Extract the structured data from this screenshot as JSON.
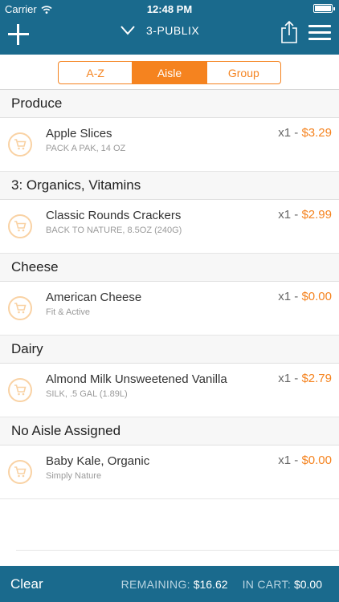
{
  "status_bar": {
    "carrier": "Carrier",
    "time": "12:48 PM"
  },
  "nav": {
    "store_name": "3-PUBLIX",
    "add_icon": "plus-icon",
    "share_icon": "share-icon",
    "menu_icon": "hamburger-menu-icon"
  },
  "sort_tabs": [
    {
      "label": "A-Z",
      "active": false
    },
    {
      "label": "Aisle",
      "active": true
    },
    {
      "label": "Group",
      "active": false
    }
  ],
  "sections": [
    {
      "title": "Produce",
      "items": [
        {
          "name": "Apple Slices",
          "subtitle": "PACK A PAK, 14 OZ",
          "qty": "x1",
          "sep": " - ",
          "price": "$3.29"
        }
      ]
    },
    {
      "title": "3: Organics, Vitamins",
      "items": [
        {
          "name": "Classic Rounds Crackers",
          "subtitle": "BACK TO NATURE, 8.5OZ (240G)",
          "qty": "x1",
          "sep": " - ",
          "price": "$2.99"
        }
      ]
    },
    {
      "title": "Cheese",
      "items": [
        {
          "name": "American Cheese",
          "subtitle": "Fit & Active",
          "qty": "x1",
          "sep": " - ",
          "price": "$0.00"
        }
      ]
    },
    {
      "title": "Dairy",
      "items": [
        {
          "name": "Almond Milk Unsweetened Vanilla",
          "subtitle": "SILK, .5 GAL (1.89L)",
          "qty": "x1",
          "sep": " - ",
          "price": "$2.79"
        }
      ]
    },
    {
      "title": "No Aisle Assigned",
      "items": [
        {
          "name": "Baby Kale, Organic",
          "subtitle": "Simply Nature",
          "qty": "x1",
          "sep": " - ",
          "price": "$0.00"
        }
      ]
    }
  ],
  "footer": {
    "clear_label": "Clear",
    "remaining_label": "REMAINING:",
    "remaining_value": "$16.62",
    "incart_label": "IN CART:",
    "incart_value": "$0.00"
  },
  "colors": {
    "bar": "#1a6a8d",
    "accent": "#f5831f",
    "cart_icon": "#f9d2a4"
  }
}
